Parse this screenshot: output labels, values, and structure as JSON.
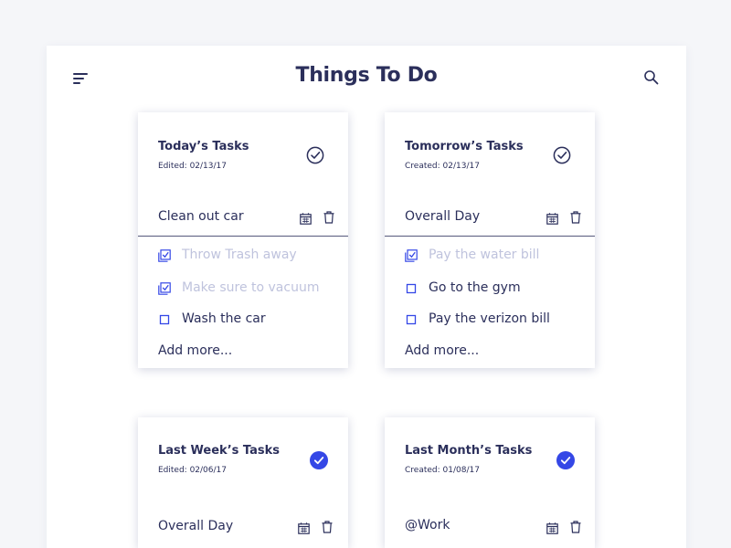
{
  "header": {
    "title": "Things To Do",
    "menu_icon": "hamburger-menu-icon",
    "search_icon": "search-icon"
  },
  "colors": {
    "navy": "#2b2f5b",
    "accent": "#3447e6",
    "muted": "#bfc3dd",
    "background": "#f5f6f9"
  },
  "cards": [
    {
      "title": "Today’s Tasks",
      "date": "Edited: 02/13/17",
      "status": "outline-check",
      "subject": "Clean out car",
      "items": [
        {
          "text": "Throw Trash away",
          "done": true
        },
        {
          "text": "Make sure to vacuum",
          "done": true
        },
        {
          "text": "Wash the car",
          "done": false
        }
      ],
      "add_more": "Add more..."
    },
    {
      "title": "Tomorrow’s Tasks",
      "date": "Created: 02/13/17",
      "status": "outline-check",
      "subject": "Overall Day",
      "items": [
        {
          "text": "Pay the water bill",
          "done": true
        },
        {
          "text": "Go to the gym",
          "done": false
        },
        {
          "text": "Pay the verizon bill",
          "done": false
        }
      ],
      "add_more": "Add more..."
    },
    {
      "title": "Last Week’s Tasks",
      "date": "Edited: 02/06/17",
      "status": "filled-check",
      "subject": "Overall Day",
      "items": [],
      "add_more": ""
    },
    {
      "title": "Last Month’s Tasks",
      "date": "Created: 01/08/17",
      "status": "filled-check",
      "subject": "@Work",
      "items": [],
      "add_more": ""
    }
  ]
}
